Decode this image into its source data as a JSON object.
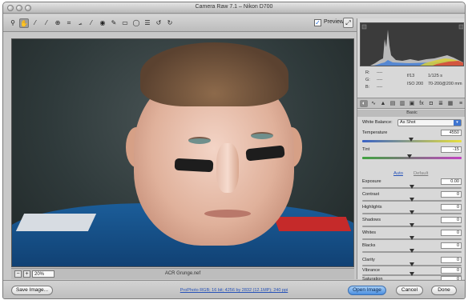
{
  "window": {
    "title": "Camera Raw 7.1  –  Nikon D700"
  },
  "toolbar": {
    "tools": [
      "zoom-icon",
      "hand-icon",
      "white-balance-icon",
      "color-sampler-icon",
      "target-adjust-icon",
      "crop-icon",
      "straighten-icon",
      "spot-removal-icon",
      "red-eye-icon",
      "adjustment-brush-icon",
      "graduated-filter-icon",
      "radial-icon",
      "preferences-icon",
      "rotate-left-icon",
      "rotate-right-icon"
    ],
    "preview_label": "Preview",
    "preview_checked": true
  },
  "image": {
    "zoom": "20%",
    "filename": "ACR Grunge.nef"
  },
  "readout": {
    "r_label": "R:",
    "g_label": "G:",
    "b_label": "B:",
    "r_value": "----",
    "g_value": "----",
    "b_value": "----",
    "aperture": "f/13",
    "shutter": "1/125 s",
    "iso": "ISO 200",
    "lens": "70-200@200 mm"
  },
  "panel": {
    "section_title": "Basic",
    "white_balance_label": "White Balance:",
    "white_balance_value": "As Shot",
    "temperature_label": "Temperature",
    "temperature_value": "4550",
    "tint_label": "Tint",
    "tint_value": "-15",
    "auto_label": "Auto",
    "default_label": "Default",
    "exposure_label": "Exposure",
    "exposure_value": "0.00",
    "contrast_label": "Contrast",
    "contrast_value": "0",
    "highlights_label": "Highlights",
    "highlights_value": "0",
    "shadows_label": "Shadows",
    "shadows_value": "0",
    "whites_label": "Whites",
    "whites_value": "0",
    "blacks_label": "Blacks",
    "blacks_value": "0",
    "clarity_label": "Clarity",
    "clarity_value": "0",
    "vibrance_label": "Vibrance",
    "vibrance_value": "0",
    "saturation_label": "Saturation",
    "saturation_value": "0"
  },
  "bottom": {
    "save_label": "Save Image...",
    "workflow_text": "ProPhoto RGB; 16 bit; 4256 by 2832 (12.1MP); 240 ppi",
    "open_label": "Open Image",
    "cancel_label": "Cancel",
    "done_label": "Done"
  },
  "colors": {
    "accent": "#3f75d0",
    "link": "#2652b8"
  }
}
